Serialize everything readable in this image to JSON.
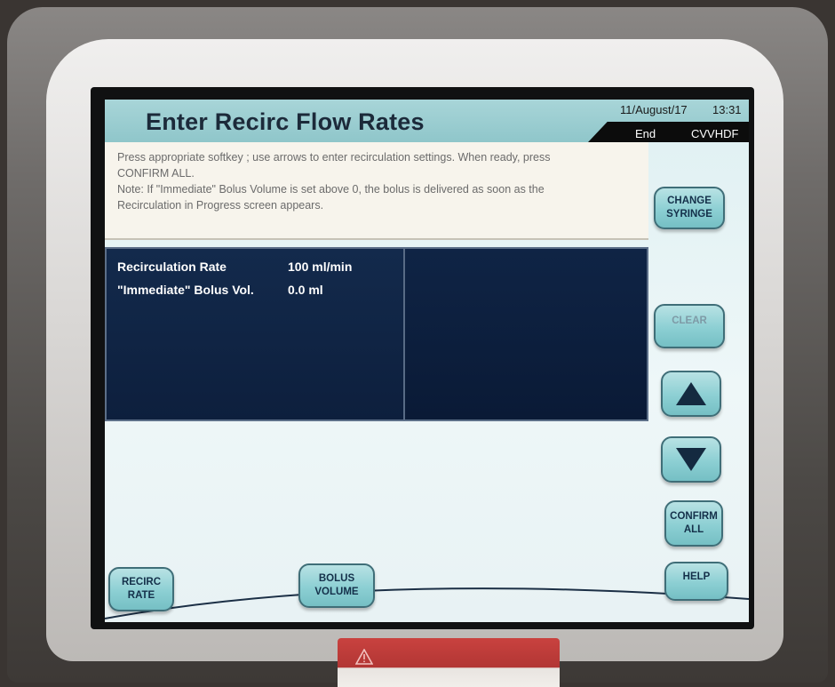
{
  "header": {
    "title": "Enter Recirc Flow Rates",
    "date": "11/August/17",
    "time": "13:31",
    "status": "End",
    "therapy_mode": "CVVHDF"
  },
  "instructions": {
    "lines": [
      "Press appropriate softkey ; use arrows to enter recirculation settings. When ready, press",
      "CONFIRM ALL.",
      "Note:  If \"Immediate\" Bolus Volume is set above 0, the bolus is delivered as soon as the",
      "Recirculation in Progress screen appears."
    ]
  },
  "settings": [
    {
      "label": "Recirculation Rate",
      "value": "100 ml/min"
    },
    {
      "label": "\"Immediate\" Bolus Vol.",
      "value": "0.0 ml"
    }
  ],
  "softkeys": {
    "change_syringe": [
      "CHANGE",
      "SYRINGE"
    ],
    "clear": "CLEAR",
    "confirm_all": [
      "CONFIRM",
      "ALL"
    ],
    "help": "HELP",
    "recirc_rate": [
      "RECIRC",
      "RATE"
    ],
    "bolus_volume": [
      "BOLUS",
      "VOLUME"
    ]
  },
  "icons": {
    "up": "triangle-up-icon",
    "down": "triangle-down-icon",
    "warning": "warning-triangle-icon"
  },
  "colors": {
    "header_bg": "#8fc6ca",
    "panel_bg": "#0d1f3d",
    "button_bg": "#8ccfd3",
    "warning_red": "#b23634"
  }
}
